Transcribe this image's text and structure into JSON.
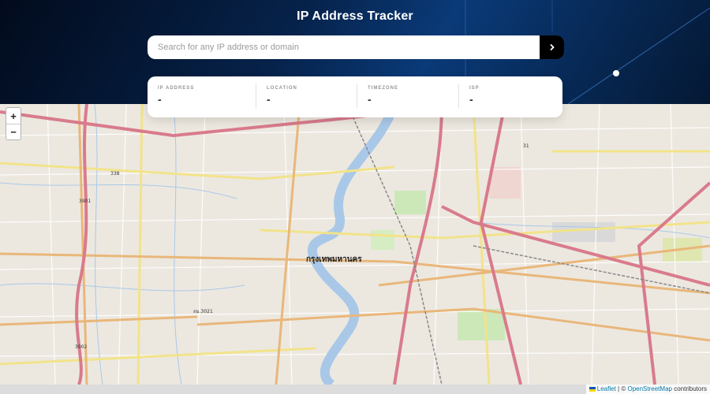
{
  "header": {
    "title": "IP Address Tracker",
    "search_placeholder": "Search for any IP address or domain",
    "search_value": "",
    "submit_icon": "chevron-right-icon"
  },
  "info": [
    {
      "label": "IP ADDRESS",
      "value": "-"
    },
    {
      "label": "LOCATION",
      "value": "-"
    },
    {
      "label": "TIMEZONE",
      "value": "-"
    },
    {
      "label": "ISP",
      "value": "-"
    }
  ],
  "map": {
    "zoom_in": "+",
    "zoom_out": "−",
    "city_label": "กรุงเทพมหานคร",
    "road_shields": [
      "338",
      "3901",
      "3902",
      "ถม.3021",
      "31"
    ],
    "attribution_leaflet": "Leaflet",
    "attribution_sep": "|",
    "attribution_copy": "©",
    "attribution_osm": "OpenStreetMap",
    "attribution_suffix": "contributors"
  },
  "colors": {
    "accent_dark": "#020b1c",
    "accent_blue": "#0a3a78",
    "button": "#000000",
    "river": "#a9c8e8"
  }
}
